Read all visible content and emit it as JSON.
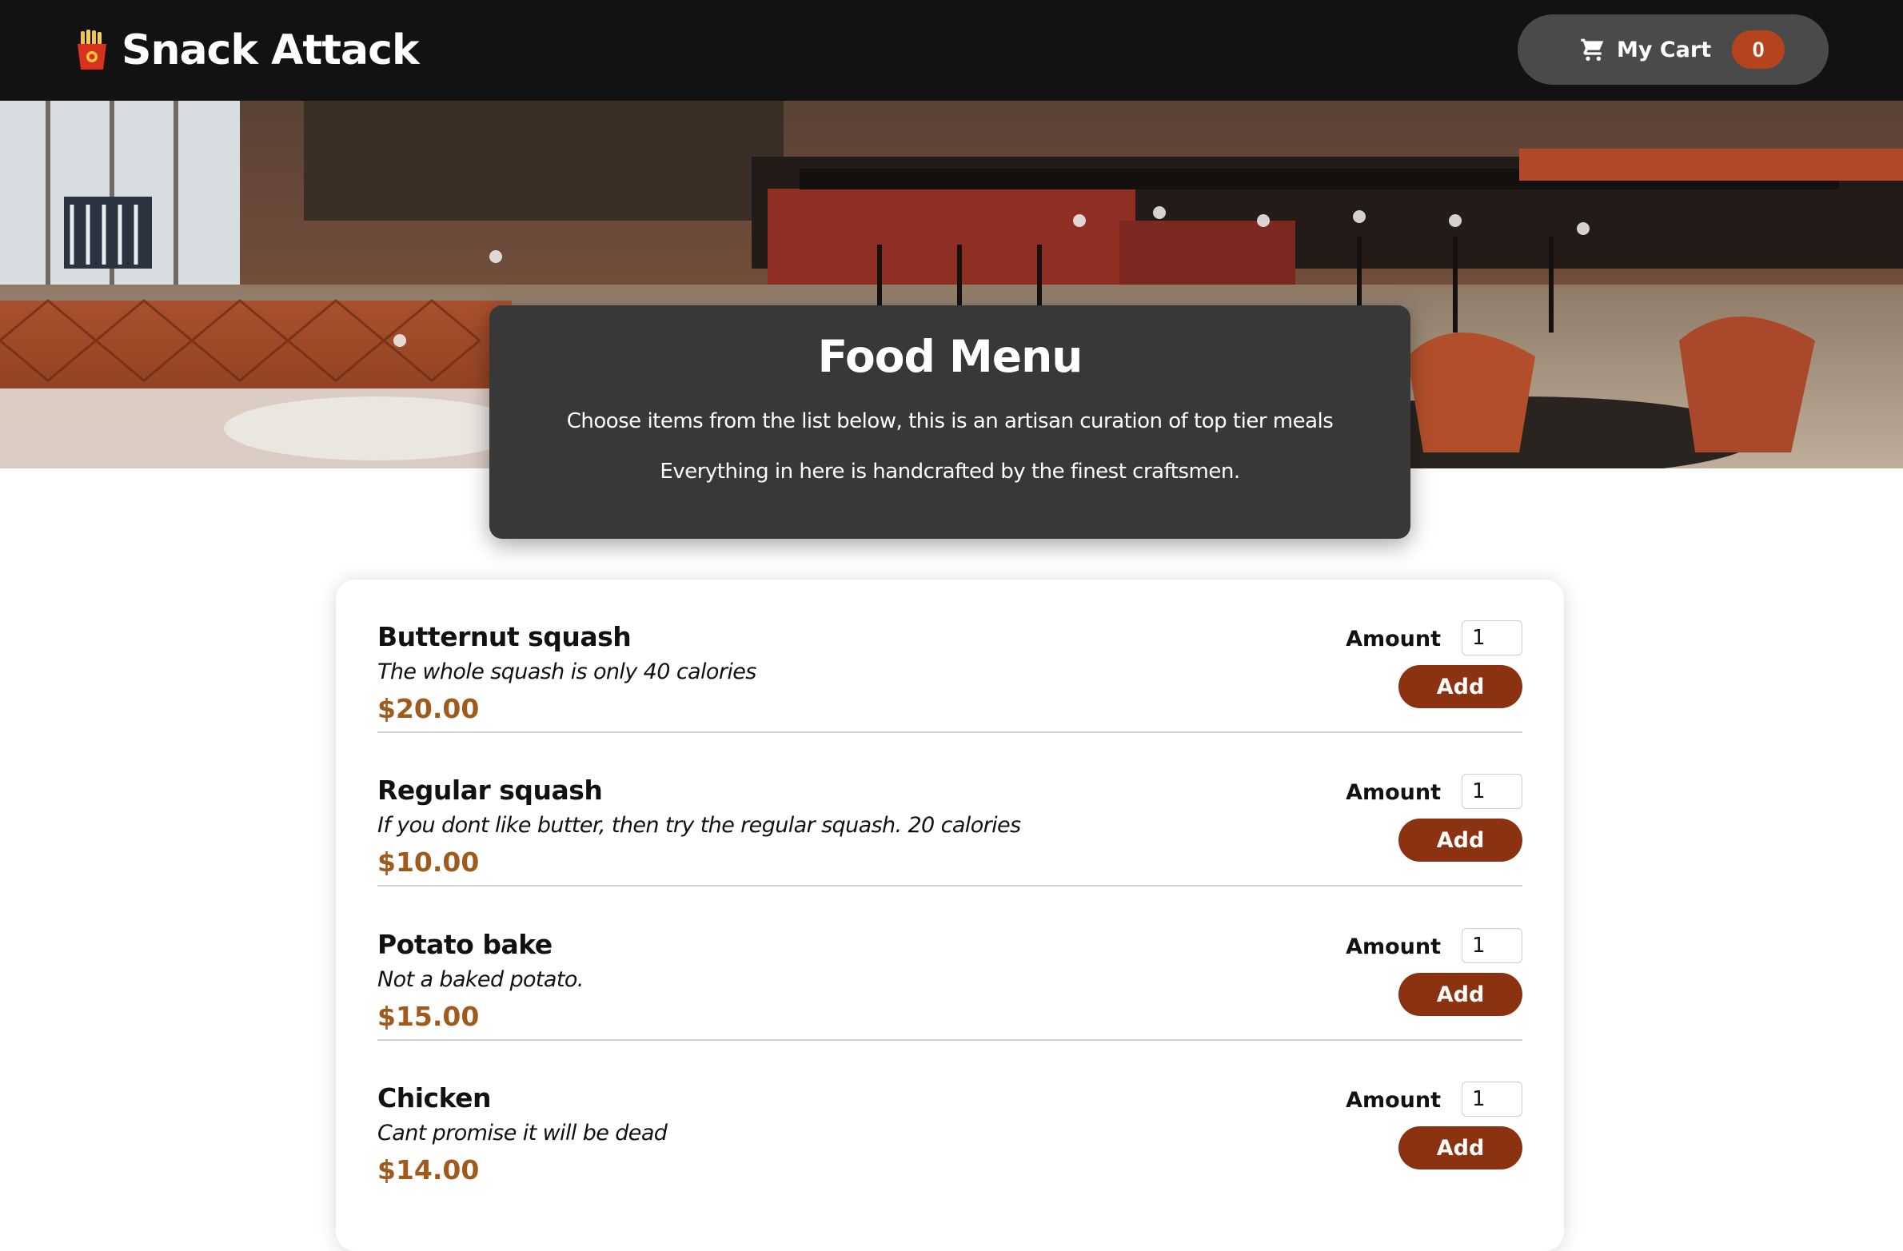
{
  "header": {
    "logo_icon": "fries-icon",
    "title": "Snack Attack",
    "cart": {
      "icon": "shopping-cart-icon",
      "label": "My Cart",
      "count": "0"
    }
  },
  "hero": {
    "image": "restaurant-interior-photo",
    "title": "Food Menu",
    "lines": [
      "Choose items from the list below, this is an artisan curation of top tier meals",
      "Everything in here is handcrafted by the finest craftsmen."
    ]
  },
  "meals": [
    {
      "name": "Butternut squash",
      "description": "The whole squash is only 40 calories",
      "price": "$20.00",
      "amount_label": "Amount",
      "amount": "1",
      "add_label": "Add"
    },
    {
      "name": "Regular squash",
      "description": "If you dont like butter, then try the regular squash. 20 calories",
      "price": "$10.00",
      "amount_label": "Amount",
      "amount": "1",
      "add_label": "Add"
    },
    {
      "name": "Potato bake",
      "description": "Not a baked potato.",
      "price": "$15.00",
      "amount_label": "Amount",
      "amount": "1",
      "add_label": "Add"
    },
    {
      "name": "Chicken",
      "description": "Cant promise it will be dead",
      "price": "$14.00",
      "amount_label": "Amount",
      "amount": "1",
      "add_label": "Add"
    }
  ],
  "colors": {
    "header_bg": "#121212",
    "cart_button_bg": "#4a4a4a",
    "cart_badge_bg": "#b5431b",
    "menu_card_bg": "#383838",
    "add_button_bg": "#8b3211",
    "price_text": "#a05a1c"
  }
}
